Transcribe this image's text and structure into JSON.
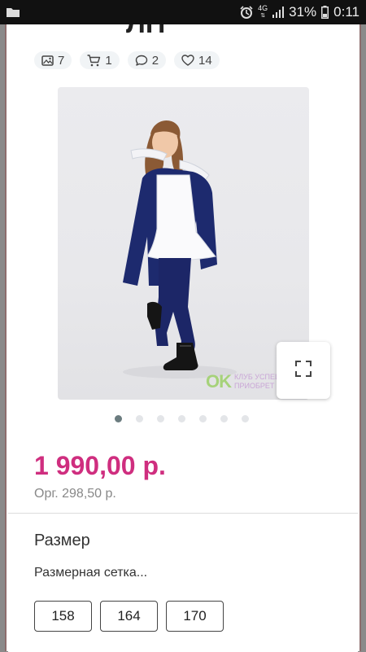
{
  "status_bar": {
    "network": "4G",
    "battery": "31%",
    "time": "0:11"
  },
  "product": {
    "title_fragment": "ЛП",
    "stats": [
      {
        "icon": "image-icon",
        "value": "7"
      },
      {
        "icon": "cart-icon",
        "value": "1"
      },
      {
        "icon": "comment-icon",
        "value": "2"
      },
      {
        "icon": "heart-icon",
        "value": "14"
      }
    ],
    "watermark": {
      "logo": "OK",
      "line1": "КЛУБ УСПЕШ",
      "line2": "ПРИОБРЕТ"
    },
    "gallery": {
      "total": 7,
      "active": 1
    },
    "price": "1 990,00 р.",
    "org_price": "Орг. 298,50 р."
  },
  "size_section": {
    "title": "Размер",
    "chart_link": "Размерная сетка...",
    "sizes": [
      "158",
      "164",
      "170"
    ]
  },
  "colors": {
    "price": "#cf2e7f",
    "watermark_logo": "#a6d27a"
  }
}
